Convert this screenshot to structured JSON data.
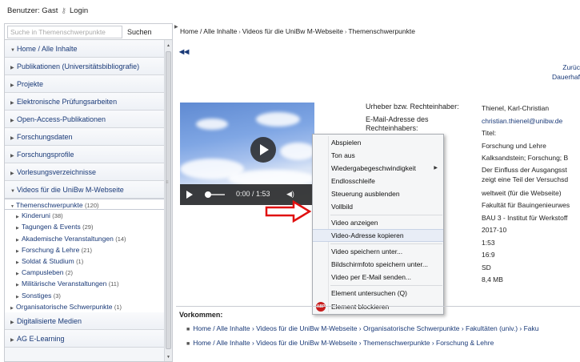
{
  "topbar": {
    "user_text": "Benutzer: Gast",
    "login_icon": "key-icon",
    "login_label": "Login"
  },
  "search": {
    "placeholder": "Suche in Themenschwerpunkte",
    "button_label": "Suchen"
  },
  "nav": {
    "home": "Home / Alle Inhalte",
    "publikationen": "Publikationen (Universitätsbibliografie)",
    "projekte": "Projekte",
    "pruefungsarbeiten": "Elektronische Prüfungsarbeiten",
    "open_access": "Open-Access-Publikationen",
    "forschungsdaten": "Forschungsdaten",
    "forschungsprofile": "Forschungsprofile",
    "vorlesungen": "Vorlesungsverzeichnisse",
    "videos": "Videos für die UniBw M-Webseite",
    "themen": "Themenschwerpunkte",
    "themen_count": "(120)",
    "sub_items": [
      {
        "label": "Kinderuni",
        "count": "(38)"
      },
      {
        "label": "Tagungen & Events",
        "count": "(29)"
      },
      {
        "label": "Akademische Veranstaltungen",
        "count": "(14)"
      },
      {
        "label": "Forschung & Lehre",
        "count": "(21)"
      },
      {
        "label": "Soldat & Studium",
        "count": "(1)"
      },
      {
        "label": "Campusleben",
        "count": "(2)"
      },
      {
        "label": "Militärische Veranstaltungen",
        "count": "(11)"
      },
      {
        "label": "Sonstiges",
        "count": "(3)"
      }
    ],
    "org_schwerpunkte": "Organisatorische Schwerpunkte",
    "org_count": "(1)",
    "digitalisierte": "Digitalisierte Medien",
    "elearning": "AG E-Learning"
  },
  "breadcrumb": [
    "Home / Alle Inhalte",
    "Videos für die UniBw M-Webseite",
    "Themenschwerpunkte"
  ],
  "back_links": {
    "zurueck": "Zurüc",
    "dauerhaft": "Dauerhaf"
  },
  "video": {
    "time": "0:00 / 1:53"
  },
  "meta": {
    "label_urheber": "Urheber bzw. Rechteinhaber:",
    "label_email": "E-Mail-Adresse des Rechteinhabers:",
    "values": [
      "Thienel, Karl-Christian",
      "christian.thienel@unibw.de",
      "Titel:",
      "Forschung und Lehre",
      "Kalksandstein; Forschung; B",
      "Der Einfluss der Ausgangsst",
      "zeigt eine Teil der Versuchsd",
      "weltweit (für die Webseite)",
      "Fakultät für Bauingenieurwes",
      "BAU 3 - Institut für Werkstoff",
      "2017-10",
      "1:53",
      "16:9",
      "SD",
      "8,4 MB"
    ]
  },
  "context_menu": {
    "abspielen": "Abspielen",
    "ton_aus": "Ton aus",
    "wiedergabe": "Wiedergabegeschwindigkeit",
    "endlos": "Endlosschleife",
    "steuerung": "Steuerung ausblenden",
    "vollbild": "Vollbild",
    "video_anzeigen": "Video anzeigen",
    "adresse_kopieren": "Video-Adresse kopieren",
    "speichern": "Video speichern unter...",
    "bildschirmfoto": "Bildschirmfoto speichern unter...",
    "email": "Video per E-Mail senden...",
    "untersuchen": "Element untersuchen (Q)",
    "blockieren": "Element blockieren",
    "abp_badge": "ABP"
  },
  "vorkommen": {
    "title": "Vorkommen:",
    "line1": "Home / Alle Inhalte › Videos für die UniBw M-Webseite › Organisatorische Schwerpunkte › Fakultäten (univ.) › Faku",
    "line2": "Home / Alle Inhalte › Videos für die UniBw M-Webseite › Themenschwerpunkte › Forschung & Lehre"
  }
}
